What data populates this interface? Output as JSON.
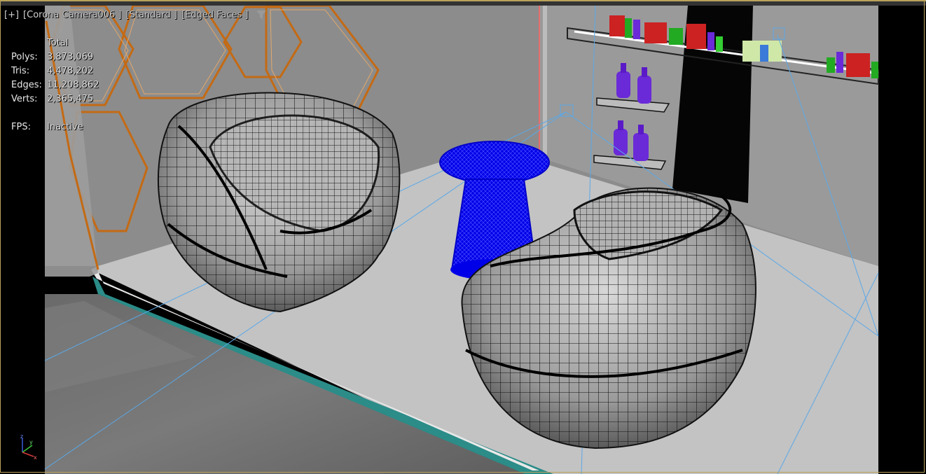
{
  "viewport": {
    "plus_menu": "[+]",
    "camera_menu": "[Corona Camera006 ]",
    "shading_menu": "[Standard ]",
    "display_menu": "[Edged Faces ]",
    "filter_icon": "funnel-icon"
  },
  "stats": {
    "header": "Total",
    "rows": [
      {
        "label": "Polys:",
        "value": "3,873,069"
      },
      {
        "label": "Tris:",
        "value": "4,478,202"
      },
      {
        "label": "Edges:",
        "value": "11,208,862"
      },
      {
        "label": "Verts:",
        "value": "2,365,475"
      }
    ],
    "fps_label": "FPS:",
    "fps_value": "Inactive"
  },
  "gizmo": {
    "z": "z",
    "y": "y",
    "x": "x"
  },
  "colors": {
    "frame": "#b9a25a",
    "wall": "#8a8a8a",
    "floor": "#c4c4c4",
    "teal_edge": "#2a8a86",
    "selected_table": "#1010ff",
    "wire_orange": "#c06010",
    "camera_lines": "#5aa8e8",
    "bottles_purple": "#6a2ad8"
  }
}
